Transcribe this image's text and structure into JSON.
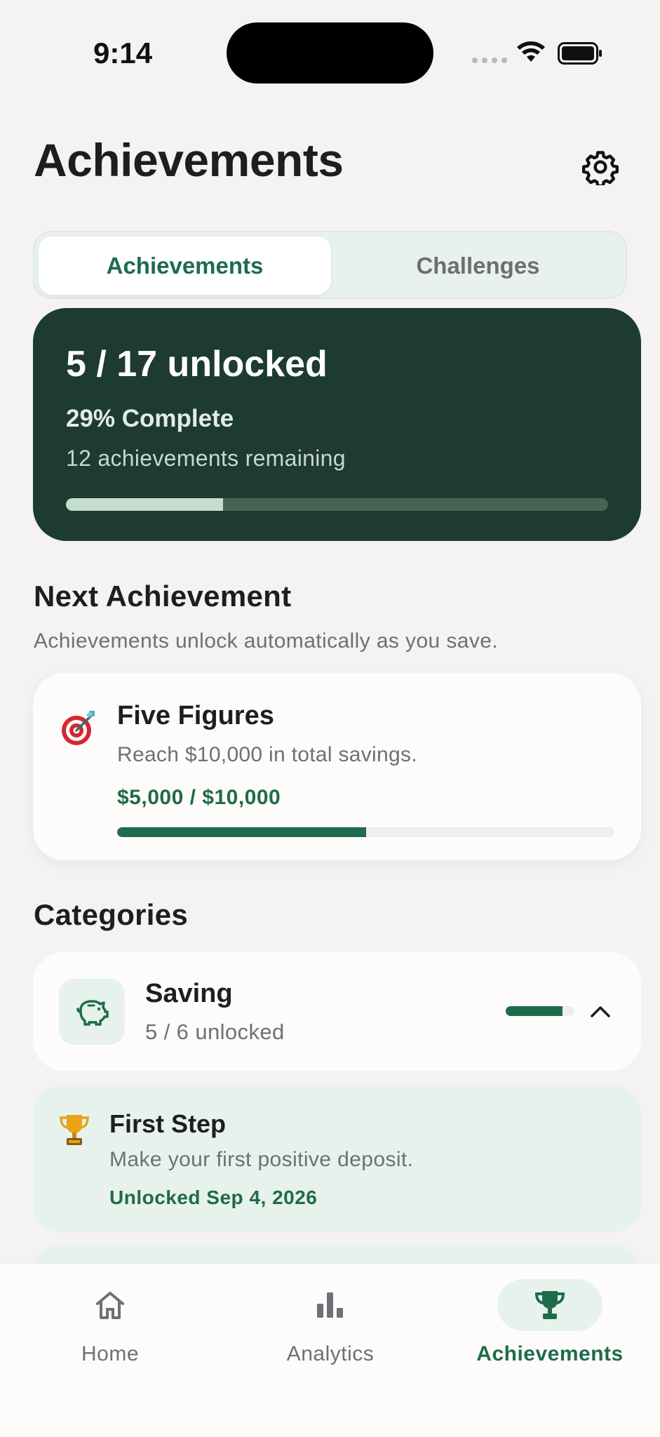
{
  "status_bar": {
    "time": "9:14"
  },
  "header": {
    "title": "Achievements",
    "settings_icon": "gear-icon"
  },
  "segmented": {
    "tabs": [
      "Achievements",
      "Challenges"
    ],
    "selected": "Achievements"
  },
  "summary": {
    "unlocked_text": "5 / 17 unlocked",
    "percent_text": "29% Complete",
    "remaining_text": "12 achievements remaining",
    "progress": 0.29
  },
  "next_achievement": {
    "section_title": "Next Achievement",
    "subtitle": "Achievements unlock automatically as you save.",
    "icon": "target-icon",
    "name": "Five Figures",
    "description": "Reach $10,000 in total savings.",
    "progress_text": "$5,000 / $10,000",
    "progress": 0.5
  },
  "categories": {
    "section_title": "Categories",
    "items": [
      {
        "name": "Saving",
        "count_text": "5 / 6 unlocked",
        "icon": "piggy-bank-icon",
        "progress": 0.83,
        "expanded": true
      }
    ]
  },
  "achievements": [
    {
      "icon": "trophy-icon",
      "name": "First Step",
      "description": "Make your first positive deposit.",
      "status": "Unlocked Sep 4, 2026"
    }
  ],
  "tab_bar": {
    "items": [
      {
        "label": "Home",
        "icon": "home-icon"
      },
      {
        "label": "Analytics",
        "icon": "bar-chart-icon"
      },
      {
        "label": "Achievements",
        "icon": "trophy-icon"
      }
    ],
    "active": "Achievements"
  },
  "colors": {
    "accent": "#1f6b4d",
    "dark_card": "#1d3b30",
    "light_green": "#e6f2eb",
    "background": "#f4f3f1"
  }
}
